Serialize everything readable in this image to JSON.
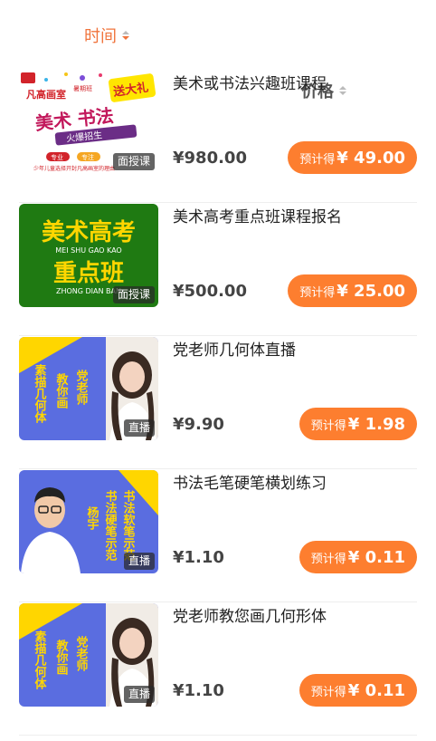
{
  "sort": {
    "time_label": "时间",
    "price_label": "价格"
  },
  "colors": {
    "accent": "#fd7e2f",
    "sort_active": "#f0743c",
    "price_text": "#444444"
  },
  "items": [
    {
      "title": "美术或书法兴趣班课程",
      "badge": "面授课",
      "price": "¥980.00",
      "earn_label": "预计得",
      "earn_amount": "¥ 49.00",
      "poster": {
        "school": "凡高画室",
        "season": "暑期班",
        "headline": "美术 书法",
        "sub": "火爆招生",
        "gift": "送大礼",
        "tag1": "专业",
        "tag2": "专注",
        "footer": "少年儿童选择开封凡高画室的理由"
      }
    },
    {
      "title": "美术高考重点班课程报名",
      "badge": "面授课",
      "price": "¥500.00",
      "earn_label": "预计得",
      "earn_amount": "¥ 25.00",
      "poster": {
        "line1": "美术高考",
        "pinyin1": "MEI SHU GAO KAO",
        "line2": "重点班",
        "pinyin2": "ZHONG DIAN BAN"
      }
    },
    {
      "title": "党老师几何体直播",
      "badge": "直播",
      "price": "¥9.90",
      "earn_label": "预计得",
      "earn_amount": "¥ 1.98",
      "poster": {
        "col1": "素描几何体",
        "col2": "教你画",
        "col3": "党老师"
      }
    },
    {
      "title": "书法毛笔硬笔横划练习",
      "badge": "直播",
      "price": "¥1.10",
      "earn_label": "预计得",
      "earn_amount": "¥ 0.11",
      "poster": {
        "col1": "杨宇",
        "col2": "书法硬笔示范",
        "col3": "书法软笔示范"
      }
    },
    {
      "title": "党老师教您画几何形体",
      "badge": "直播",
      "price": "¥1.10",
      "earn_label": "预计得",
      "earn_amount": "¥ 0.11",
      "poster": {
        "col1": "素描几何体",
        "col2": "教你画",
        "col3": "党老师"
      }
    }
  ]
}
